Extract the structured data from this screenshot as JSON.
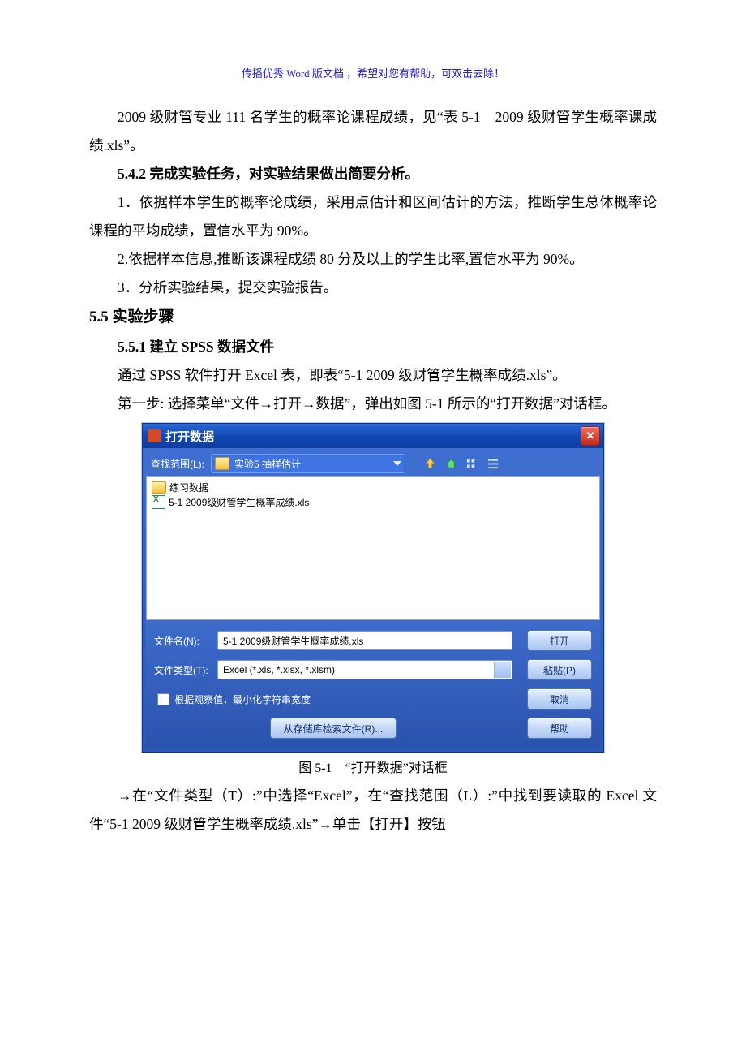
{
  "banner": "传播优秀 Word 版文档 ，希望对您有帮助，可双击去除！",
  "p1": "2009 级财管专业 111 名学生的概率论课程成绩，见“表 5-1　2009 级财管学生概率课成绩.xls”。",
  "h542": "5.4.2 完成实验任务，对实验结果做出简要分析。",
  "p2": "1．依据样本学生的概率论成绩，采用点估计和区间估计的方法，推断学生总体概率论课程的平均成绩，置信水平为 90%。",
  "p3": "2.依据样本信息,推断该课程成绩 80 分及以上的学生比率,置信水平为 90%。",
  "p4": "3．分析实验结果，提交实验报告。",
  "h55": "5.5 实验步骤",
  "h551": "5.5.1 建立 SPSS 数据文件",
  "p5": "通过 SPSS 软件打开 Excel 表，即表“5-1 2009 级财管学生概率成绩.xls”。",
  "p6": "第一步: 选择菜单“文件→打开→数据”，弹出如图 5-1 所示的“打开数据”对话框。",
  "figcap": "图 5-1　“打开数据”对话框",
  "p7": "→在“文件类型（T）:”中选择“Excel”，在“查找范围（L）:”中找到要读取的 Excel 文件“5-1 2009 级财管学生概率成绩.xls”→单击【打开】按钮",
  "dialog": {
    "title": "打开数据",
    "close_glyph": "✕",
    "look_in_label": "查找范围(L):",
    "look_in_value": "实验5 抽样估计",
    "files": [
      {
        "kind": "folder",
        "name": "练习数据"
      },
      {
        "kind": "excel",
        "name": "5-1 2009级财管学生概率成绩.xls"
      }
    ],
    "filename_label": "文件名(N):",
    "filename_value": "5-1 2009级财管学生概率成绩.xls",
    "filetype_label": "文件类型(T):",
    "filetype_value": "Excel (*.xls, *.xlsx, *.xlsm)",
    "checkbox_label": "根据观察值，最小化字符串宽度",
    "btn_open": "打开",
    "btn_paste": "粘贴(P)",
    "btn_cancel": "取消",
    "btn_help": "帮助",
    "btn_store": "从存储库检索文件(R)..."
  }
}
